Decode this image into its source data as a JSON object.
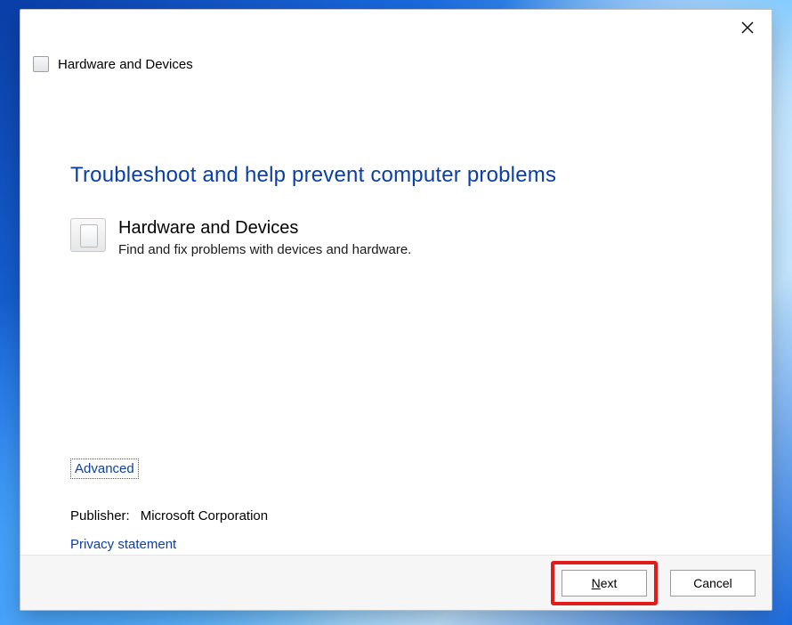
{
  "window": {
    "title": "Hardware and Devices"
  },
  "content": {
    "heading": "Troubleshoot and help prevent computer problems",
    "item": {
      "title": "Hardware and Devices",
      "description": "Find and fix problems with devices and hardware."
    },
    "advanced": "Advanced",
    "publisher": {
      "label": "Publisher:",
      "value": "Microsoft Corporation"
    },
    "privacy": "Privacy statement"
  },
  "footer": {
    "next": "Next",
    "cancel": "Cancel"
  }
}
